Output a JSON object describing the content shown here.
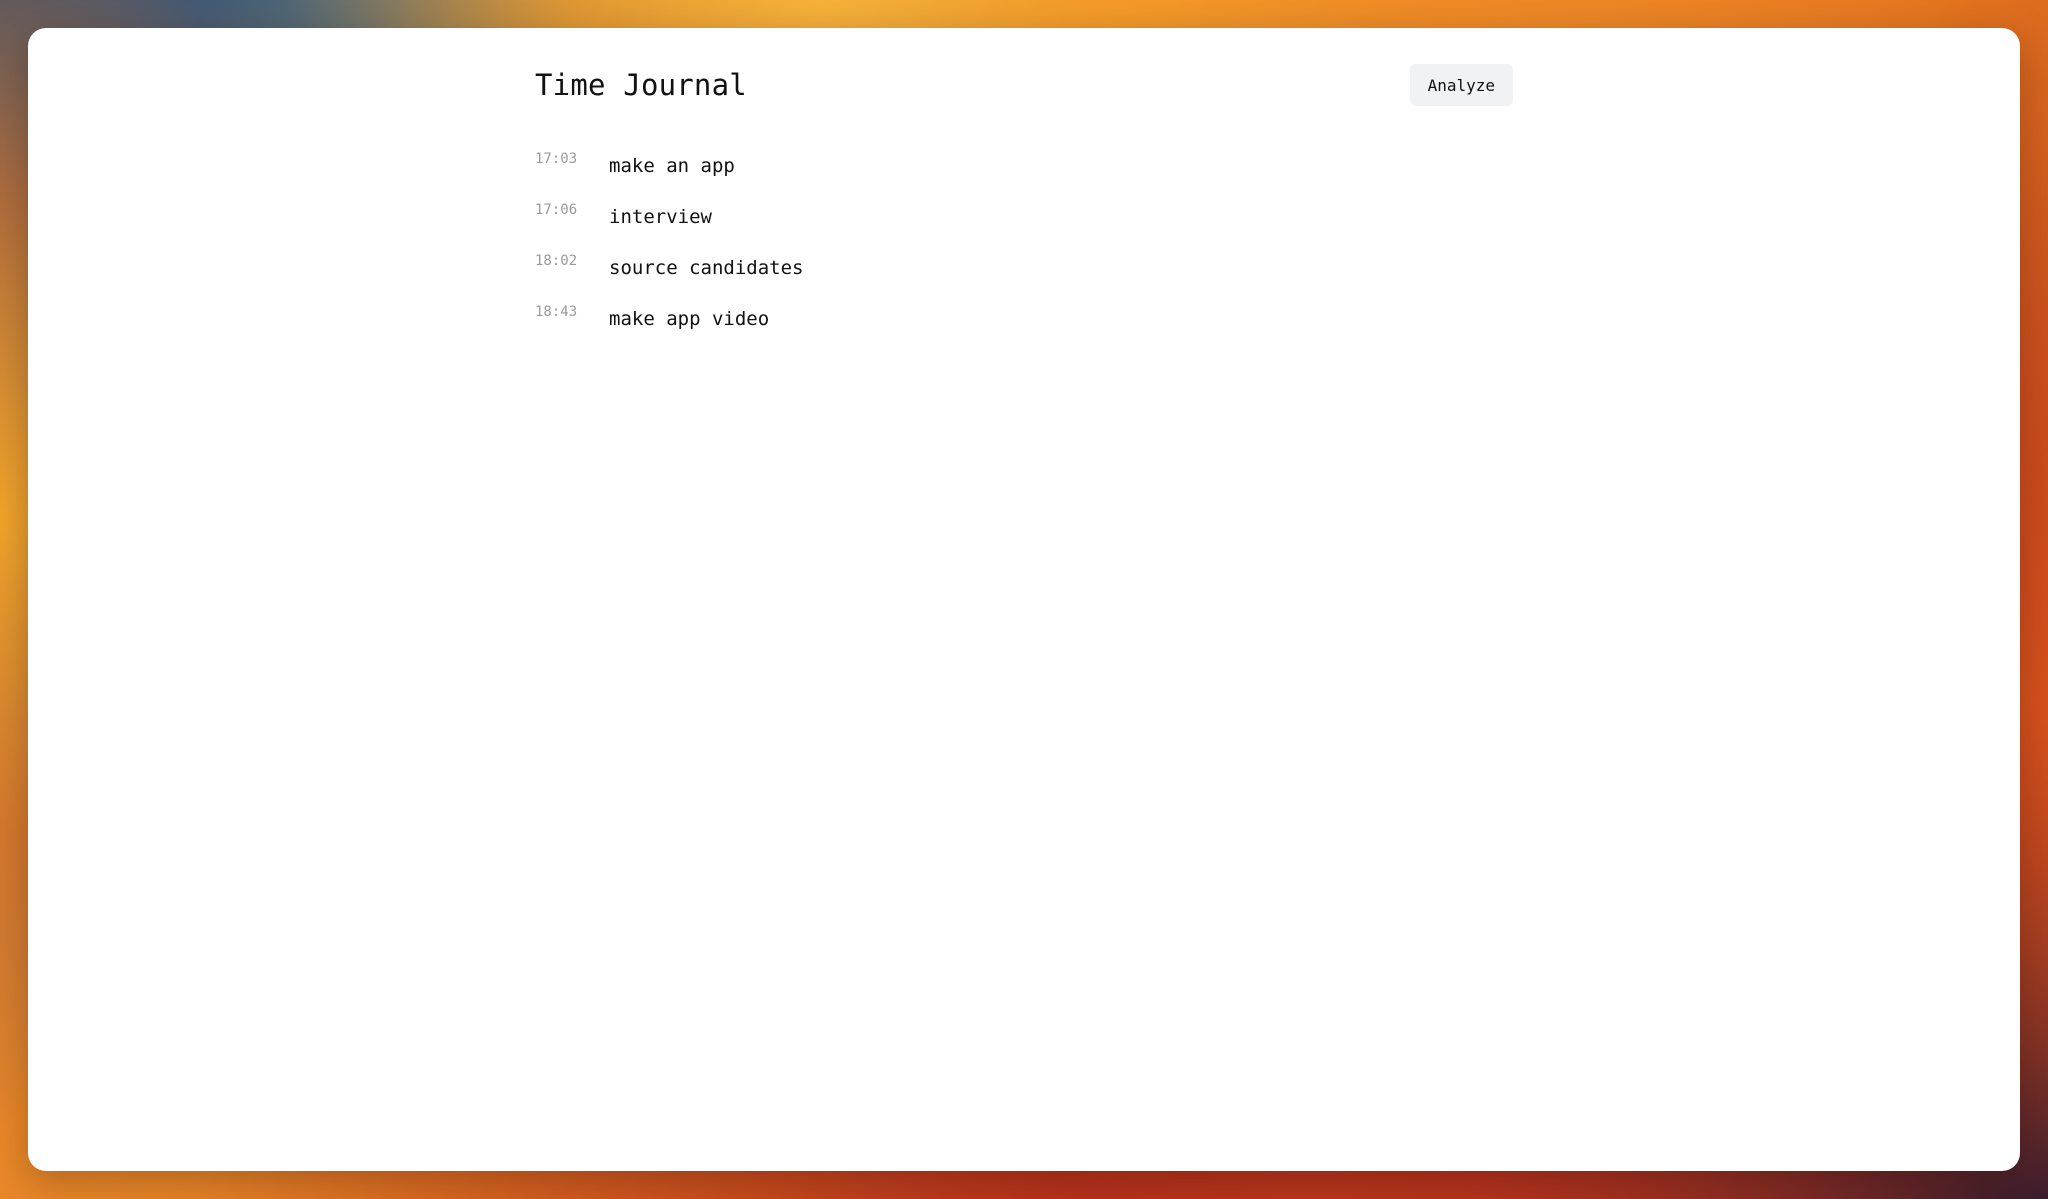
{
  "app": {
    "title": "Time Journal",
    "analyze_label": "Analyze"
  },
  "entries": [
    {
      "time": "17:03",
      "text": "make an app"
    },
    {
      "time": "17:06",
      "text": "interview"
    },
    {
      "time": "18:02",
      "text": "source candidates"
    },
    {
      "time": "18:43",
      "text": "make app video"
    }
  ],
  "colors": {
    "window_bg": "#ffffff",
    "button_bg": "#f1f2f4",
    "time_text": "#9a9a9a",
    "primary_text": "#111111"
  }
}
